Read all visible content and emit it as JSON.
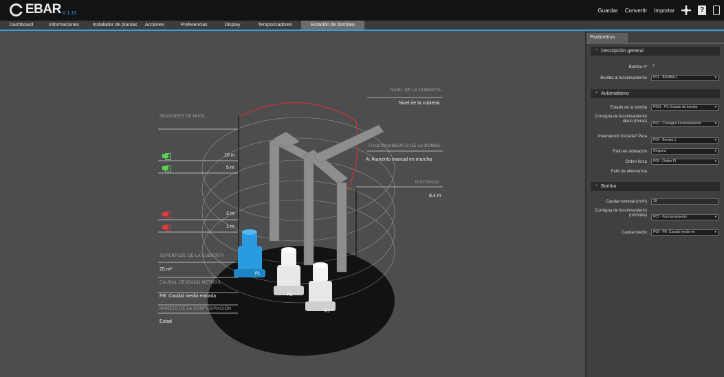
{
  "app": {
    "logo_text": "EBAR",
    "logo_sub": "V 1.15"
  },
  "topbar": {
    "actions": [
      "Guardar",
      "Convertir",
      "Importar"
    ],
    "help_label": "?"
  },
  "tabs": [
    {
      "label": "Dashboard"
    },
    {
      "label": "Informaciones"
    },
    {
      "label": "Instalador de plantas"
    },
    {
      "label": "Acciones"
    },
    {
      "label": "Preferencias"
    },
    {
      "label": "Display"
    },
    {
      "label": "Temporizadores"
    },
    {
      "label": "Estación de bombeo"
    }
  ],
  "scene": {
    "labels": {
      "level_sensors": "SENSORES DE NIVEL",
      "inlet_title": "NIVEL DE LA CUBIERTA",
      "inlet_value": "Nivel de la cubierta",
      "mode_title": "FUNCIONAMIENTO DE LA BOMBA",
      "mode_value": "A: Aumento manual en marcha",
      "height_title": "DISTANCIA",
      "height_value": "8,4 m",
      "surface_title": "SUPERFICIE DE LA CUBIERTA",
      "surface_value": "25 m²",
      "flow_title": "CAUDAL DESEADO METROS",
      "flow_value": "FR: Caudal medio entrada",
      "manage_title": "MANEJO DE LA CONFIGURACIÓN",
      "manage_value": "Estad"
    },
    "sensors": [
      {
        "color": "green",
        "value": "10 m"
      },
      {
        "color": "green",
        "value": "5 m"
      },
      {
        "color": "red",
        "value": "3 m"
      },
      {
        "color": "red",
        "value": "1 m"
      }
    ],
    "pumps": [
      "P1",
      "P2",
      "P3"
    ]
  },
  "panel": {
    "tab": "Parámetros",
    "sections": [
      {
        "title": "Descripción general",
        "rows": [
          {
            "label": "Bomba nº",
            "value": "3"
          },
          {
            "label": "Bomba al funcionamiento",
            "value": "P01 - BOMBA 1"
          }
        ]
      },
      {
        "title": "Automatismo",
        "rows": [
          {
            "label": "Estado de la bomba",
            "value": "P001 - P0: Estado de bomba"
          },
          {
            "label": "Consigna de funcionamiento diario (horas)",
            "value": "P02 - Consigna funcionamiento"
          },
          {
            "label": "Interrupción forzada? Pera",
            "value": "P04 - Bomba 1"
          },
          {
            "label": "Fallo en activación",
            "value": "Ninguna"
          },
          {
            "label": "Orden forza",
            "value": "P05 - Orden Pl"
          },
          {
            "label": "Fallo de alternancia",
            "value": ""
          }
        ]
      },
      {
        "title": "Bomba",
        "rows": [
          {
            "label": "Caudal nominal (m³/h)",
            "value": "19"
          },
          {
            "label": "Consigna de funcionamiento (m³/h/día)",
            "value": "P07 - Funcionamiento"
          },
          {
            "label": "Caudal medio",
            "value": "P08 - FR: Caudal medio en"
          }
        ]
      }
    ]
  },
  "colors": {
    "accent": "#34a3d8",
    "pump_active": "#2a9be0",
    "alarm": "#e23a3a",
    "ok": "#5fcf54",
    "ring_alert": "#d43232"
  }
}
